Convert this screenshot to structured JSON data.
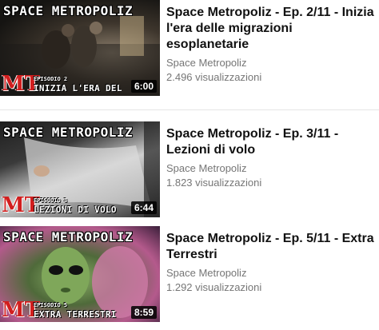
{
  "videos": [
    {
      "brand": "SPACE METROPOLIZ",
      "logo": "MT",
      "episode_small": "EPISODIO 2",
      "episode_big": "INIZIA L'ERA DELLE MIGRAZIONI ESOPLANETARIE",
      "duration": "6:00",
      "title": "Space Metropoliz - Ep. 2/11 - Inizia l'era delle migrazioni esoplanetarie",
      "channel": "Space Metropoliz",
      "views": "2.496 visualizzazioni"
    },
    {
      "brand": "SPACE METROPOLIZ",
      "logo": "MT",
      "episode_small": "EPISODIO 3",
      "episode_big": "LEZIONI DI VOLO",
      "duration": "6:44",
      "title": "Space Metropoliz - Ep. 3/11 - Lezioni di volo",
      "channel": "Space Metropoliz",
      "views": "1.823 visualizzazioni"
    },
    {
      "brand": "SPACE METROPOLIZ",
      "logo": "MT",
      "episode_small": "EPISODIO 5",
      "episode_big": "EXTRA TERRESTRI",
      "duration": "8:59",
      "title": "Space Metropoliz - Ep. 5/11 - Extra Terrestri",
      "channel": "Space Metropoliz",
      "views": "1.292 visualizzazioni"
    }
  ]
}
